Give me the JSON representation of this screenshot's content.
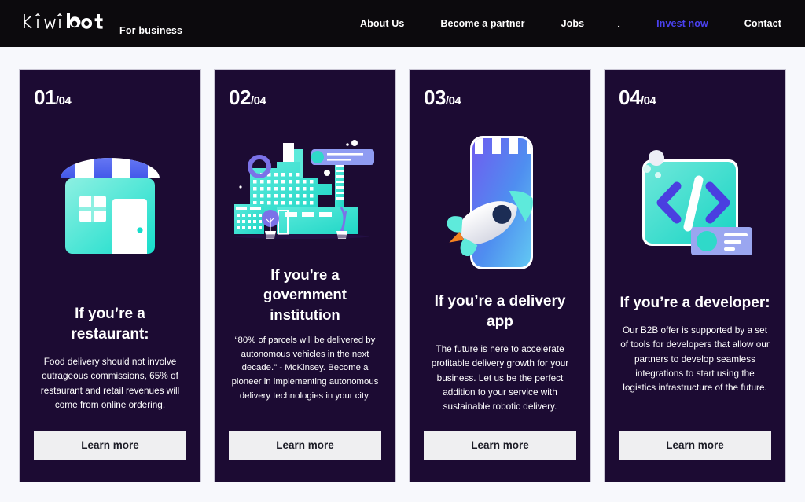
{
  "header": {
    "logo_text": "kiwibot",
    "logo_light": "kiwi",
    "logo_bold": "bot",
    "tagline": "For business",
    "accent_color": "#4a41ee",
    "nav": [
      {
        "label": "About Us",
        "accent": false
      },
      {
        "label": "Become a partner",
        "accent": false
      },
      {
        "label": "Jobs",
        "accent": false
      },
      {
        "label": ".",
        "accent": false
      },
      {
        "label": "Invest now",
        "accent": true
      },
      {
        "label": "Contact",
        "accent": false
      }
    ]
  },
  "theme": {
    "page_bg": "#f7f8fc",
    "card_bg": "#1c0b33",
    "header_bg": "#0c0a0d",
    "accent": "#4a41ee",
    "teal": "#3fe0d0",
    "button_bg": "#efeff1"
  },
  "cards": [
    {
      "index": "01",
      "total": "/04",
      "illustration": "storefront-icon",
      "title": "If you’re a restaurant:",
      "body": "Food delivery should not involve outrageous commissions, 65% of restaurant and retail revenues will come from online ordering.",
      "button": "Learn more"
    },
    {
      "index": "02",
      "total": "/04",
      "illustration": "cityscape-icon",
      "title": "If you’re a government institution",
      "body": "“80% of parcels will be delivered by autonomous vehicles in the next decade.\" - McKinsey. Become a pioneer in implementing autonomous delivery technologies in your city.",
      "button": "Learn more"
    },
    {
      "index": "03",
      "total": "/04",
      "illustration": "rocket-phone-icon",
      "title": "If you’re a delivery app",
      "body": "The future is here to accelerate profitable delivery growth for your business. Let us be the perfect addition to your service with sustainable robotic delivery.",
      "button": "Learn more"
    },
    {
      "index": "04",
      "total": "/04",
      "illustration": "code-brackets-icon",
      "title": "If you’re a developer:",
      "body": "Our B2B offer is supported by a set of tools for developers that allow our partners to develop seamless integrations to start using the logistics infrastructure of the future.",
      "button": "Learn more"
    }
  ]
}
